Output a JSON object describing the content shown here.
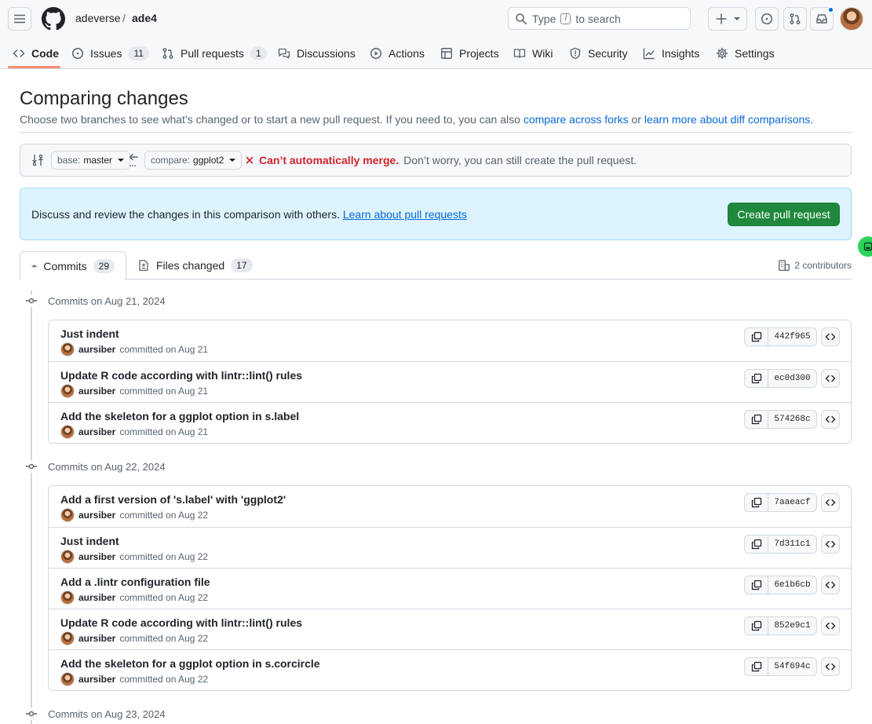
{
  "header": {
    "owner": "adeverse",
    "separator": "/",
    "repo": "ade4",
    "search": {
      "prefix": "Type",
      "key": "/",
      "suffix": "to search"
    },
    "icons": [
      "hamburger-menu-icon",
      "github-logo-icon",
      "search-icon",
      "plus-icon",
      "issue-opened-icon",
      "git-pull-request-icon",
      "inbox-icon"
    ]
  },
  "tabs": [
    {
      "label": "Code",
      "icon": "code-icon",
      "count": null,
      "active": true
    },
    {
      "label": "Issues",
      "icon": "issue-opened-icon",
      "count": "11"
    },
    {
      "label": "Pull requests",
      "icon": "git-pull-request-icon",
      "count": "1"
    },
    {
      "label": "Discussions",
      "icon": "comment-discussion-icon",
      "count": null
    },
    {
      "label": "Actions",
      "icon": "play-icon",
      "count": null
    },
    {
      "label": "Projects",
      "icon": "table-icon",
      "count": null
    },
    {
      "label": "Wiki",
      "icon": "book-icon",
      "count": null
    },
    {
      "label": "Security",
      "icon": "shield-icon",
      "count": null
    },
    {
      "label": "Insights",
      "icon": "graph-icon",
      "count": null
    },
    {
      "label": "Settings",
      "icon": "gear-icon",
      "count": null
    }
  ],
  "compare": {
    "title": "Comparing changes",
    "subtitle_prefix": "Choose two branches to see what’s changed or to start a new pull request. If you need to, you can also",
    "link_forks": "compare across forks",
    "subtitle_or": "or",
    "link_learn": "learn more about diff comparisons.",
    "base_label": "base:",
    "base_branch": "master",
    "compare_label": "compare:",
    "compare_branch": "ggplot2",
    "merge_status_bold": "Can’t automatically merge.",
    "merge_status_rest": "Don’t worry, you can still create the pull request."
  },
  "flash": {
    "text": "Discuss and review the changes in this comparison with others.",
    "link": "Learn about pull requests",
    "button": "Create pull request"
  },
  "tabnav": {
    "commits_label": "Commits",
    "commits_count": "29",
    "files_label": "Files changed",
    "files_count": "17",
    "contributors": "2 contributors"
  },
  "days": [
    {
      "heading": "Commits on Aug 21, 2024",
      "commits": [
        {
          "title": "Just indent",
          "author": "aursiber",
          "verb": "committed on Aug 21",
          "sha": "442f965"
        },
        {
          "title": "Update R code according with lintr::lint() rules",
          "author": "aursiber",
          "verb": "committed on Aug 21",
          "sha": "ec0d300"
        },
        {
          "title": "Add the skeleton for a ggplot option in s.label",
          "author": "aursiber",
          "verb": "committed on Aug 21",
          "sha": "574268c"
        }
      ]
    },
    {
      "heading": "Commits on Aug 22, 2024",
      "commits": [
        {
          "title": "Add a first version of 's.label' with 'ggplot2'",
          "author": "aursiber",
          "verb": "committed on Aug 22",
          "sha": "7aaeacf"
        },
        {
          "title": "Just indent",
          "author": "aursiber",
          "verb": "committed on Aug 22",
          "sha": "7d311c1"
        },
        {
          "title": "Add a .lintr configuration file",
          "author": "aursiber",
          "verb": "committed on Aug 22",
          "sha": "6e1b6cb"
        },
        {
          "title": "Update R code according with lintr::lint() rules",
          "author": "aursiber",
          "verb": "committed on Aug 22",
          "sha": "852e9c1"
        },
        {
          "title": "Add the skeleton for a ggplot option in s.corcircle",
          "author": "aursiber",
          "verb": "committed on Aug 22",
          "sha": "54f694c"
        }
      ]
    },
    {
      "heading": "Commits on Aug 23, 2024",
      "commits": []
    }
  ],
  "colors": {
    "accent": "#0969da",
    "primary_button": "#1f883d",
    "danger": "#d1242f",
    "tab_underline": "#fd8c73",
    "flash_bg": "#ddf4ff"
  }
}
